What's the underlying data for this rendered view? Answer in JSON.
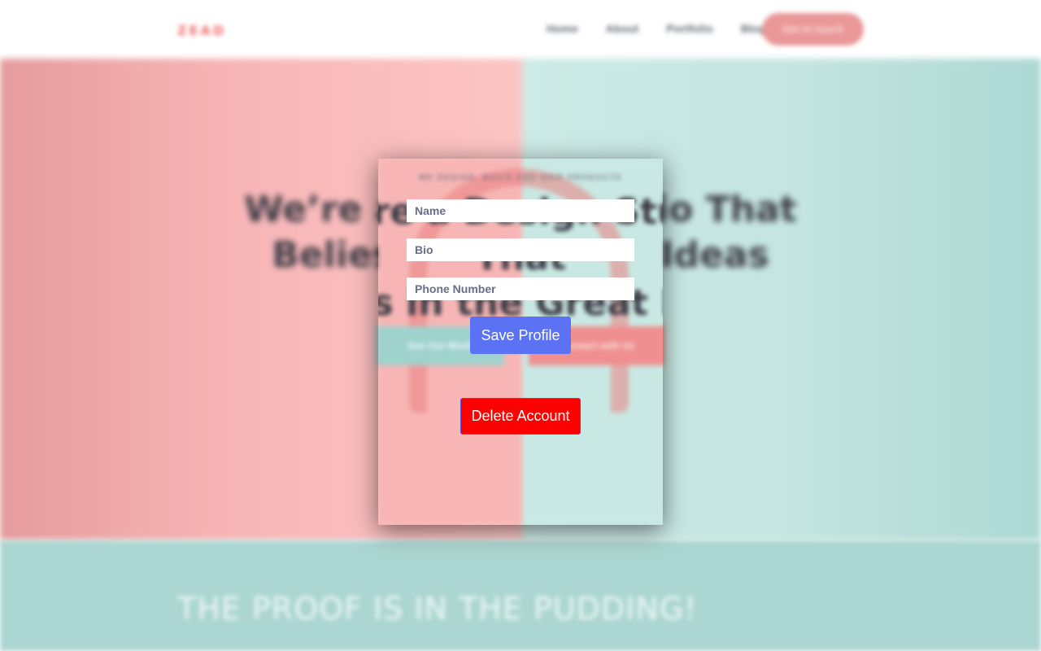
{
  "background_site": {
    "logo": "ZEAD",
    "nav": [
      "Home",
      "About",
      "Portfolio",
      "Blog"
    ],
    "cta_label": "Get in touch",
    "hero_kicker": "WE DESIGN, BUILD AND SHIP PRODUCTS",
    "hero_title_line1": "We’re a Design Studio That",
    "hero_title_line2": "Belies in the Great Ideas",
    "hero_button_left": "See Our Work",
    "hero_button_right": "Contact with Us",
    "section_title": "THE PROOF IS IN THE PUDDING!"
  },
  "profile_form": {
    "name_placeholder": "Name",
    "bio_placeholder": "Bio",
    "phone_placeholder": "Phone Number",
    "save_label": "Save Profile",
    "delete_label": "Delete Account"
  },
  "colors": {
    "save_button": "#5c72f5",
    "delete_button": "#ff0000",
    "hero_pink": "#f7b5b6",
    "hero_teal": "#c3e4df"
  }
}
